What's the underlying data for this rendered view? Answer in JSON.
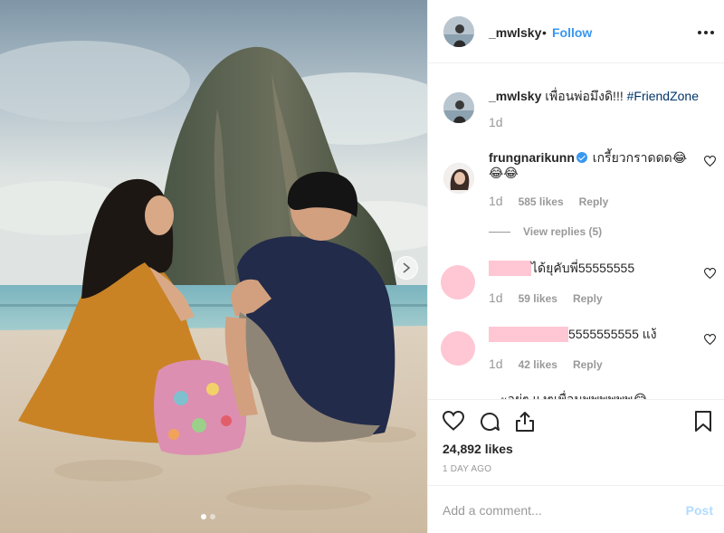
{
  "post": {
    "username": "_mwlsky",
    "separator": "•",
    "follow_label": "Follow",
    "more_icon": "more-options-icon"
  },
  "caption": {
    "username": "_mwlsky",
    "text": "เพื่อนพ่อมึงดิ!!!",
    "hashtag": "#FriendZone",
    "time": "1d"
  },
  "comments": [
    {
      "username": "frungnarikunn",
      "verified": true,
      "text_line1": "เกรี้ยวกราดดด😂",
      "text_line2": "😂😂",
      "time": "1d",
      "likes": "585 likes",
      "reply_label": "Reply",
      "view_replies": "View replies (5)"
    },
    {
      "username_redacted": true,
      "text": "ได้ยุคับพี่55555555",
      "time": "1d",
      "likes": "59 likes",
      "reply_label": "Reply"
    },
    {
      "username_redacted": true,
      "text": "5555555555 แง้",
      "time": "1d",
      "likes": "42 likes",
      "reply_label": "Reply"
    },
    {
      "text_partial": "ะอยู่ๆ แงๆเพื่อนพพพพพพ😂"
    }
  ],
  "actions": {
    "likes": "24,892 likes",
    "date": "1 DAY AGO"
  },
  "add_comment": {
    "placeholder": "Add a comment...",
    "post_label": "Post"
  },
  "colors": {
    "link": "#3897f0",
    "hashtag": "#003569",
    "redaction": "#ffc6d4",
    "muted": "#999999"
  }
}
